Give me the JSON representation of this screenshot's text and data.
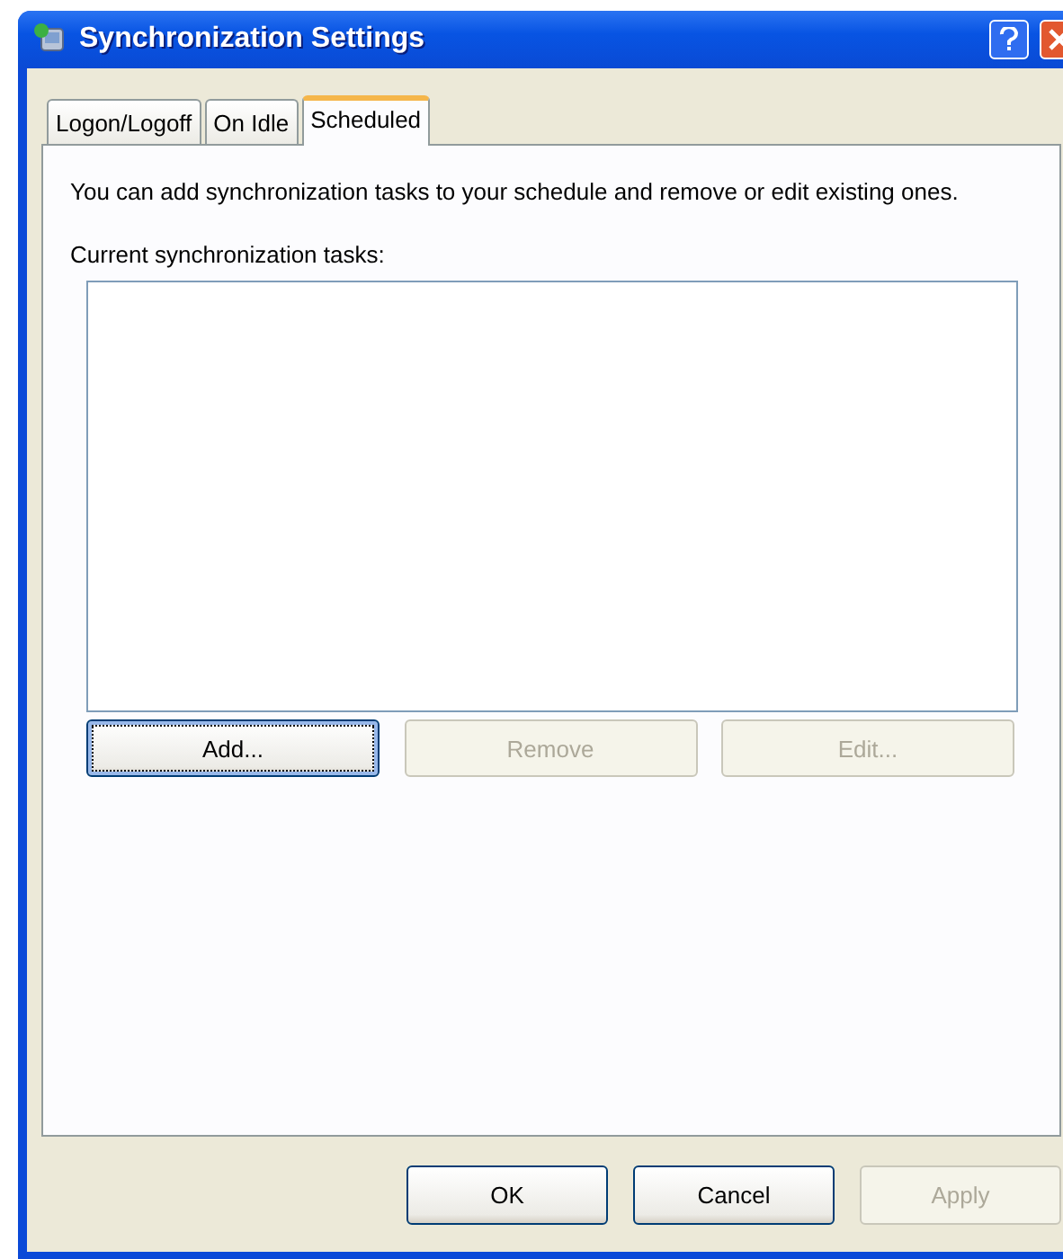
{
  "window": {
    "title": "Synchronization Settings"
  },
  "tabs": [
    {
      "label": "Logon/Logoff",
      "selected": false
    },
    {
      "label": "On Idle",
      "selected": false
    },
    {
      "label": "Scheduled",
      "selected": true
    }
  ],
  "description": "You can add synchronization tasks to your schedule and remove or edit existing ones.",
  "list_label": "Current synchronization tasks:",
  "task_buttons": [
    {
      "label": "Add...",
      "disabled": false,
      "focused": true
    },
    {
      "label": "Remove",
      "disabled": true,
      "focused": false
    },
    {
      "label": "Edit...",
      "disabled": true,
      "focused": false
    }
  ],
  "dialog_buttons": [
    {
      "label": "OK",
      "disabled": false
    },
    {
      "label": "Cancel",
      "disabled": false
    },
    {
      "label": "Apply",
      "disabled": true
    }
  ]
}
